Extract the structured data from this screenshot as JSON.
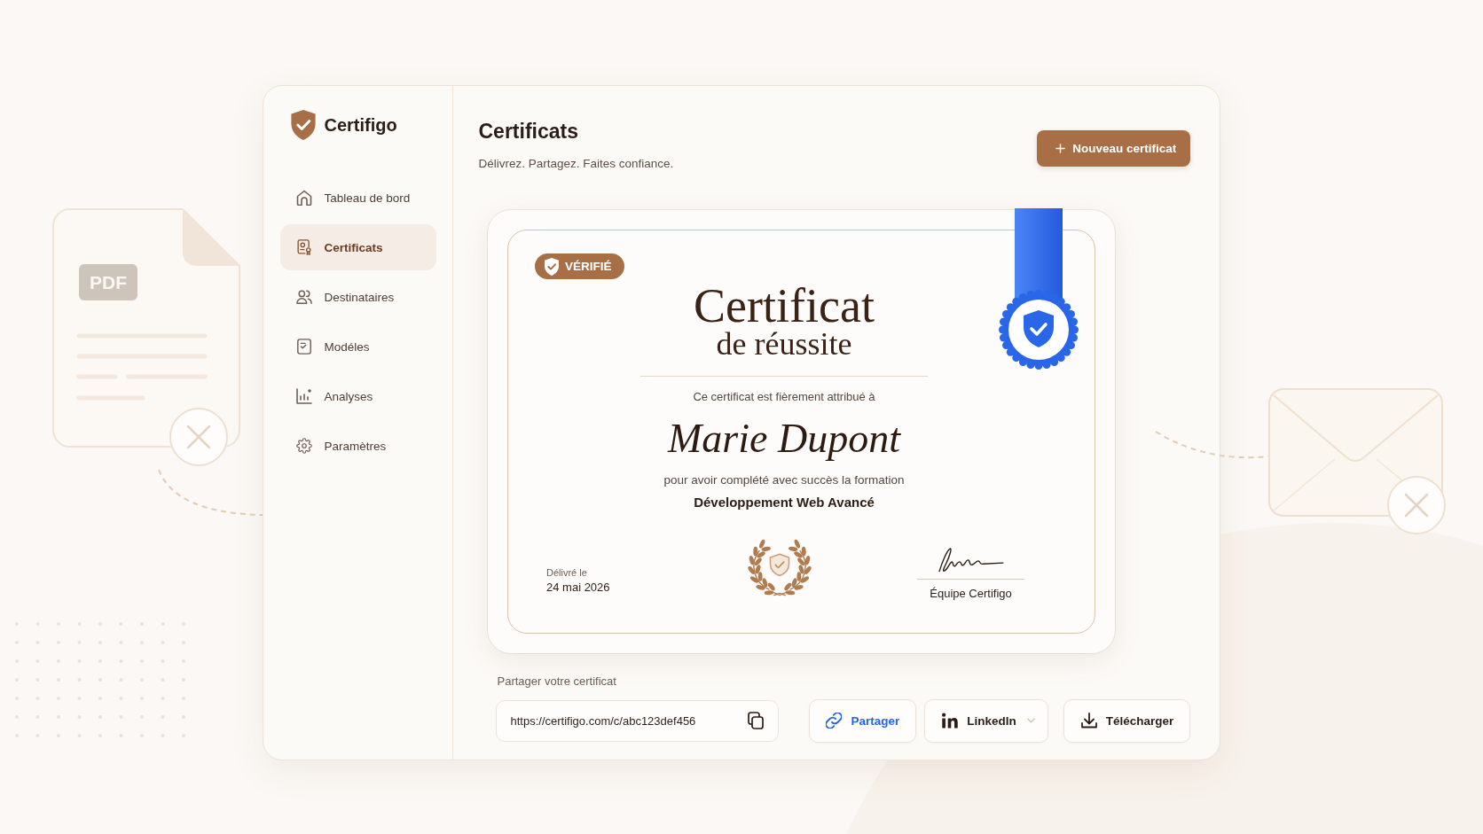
{
  "brand": {
    "name": "Certifigo"
  },
  "sidebar": {
    "items": [
      {
        "label": "Tableau de bord",
        "selected": false
      },
      {
        "label": "Certificats",
        "selected": true
      },
      {
        "label": "Destinataires",
        "selected": false
      },
      {
        "label": "Modéles",
        "selected": false
      },
      {
        "label": "Analyses",
        "selected": false
      },
      {
        "label": "Paramètres",
        "selected": false
      }
    ]
  },
  "header": {
    "title": "Certificats",
    "subtitle": "Délivrez. Partagez. Faites confiance.",
    "action": "Nouveau certificat"
  },
  "certificate": {
    "badge": "VÉRIFIÉ",
    "title": "Certificat",
    "subtitle": "de réussite",
    "intro": "Ce certificat est fièrement attribué à",
    "recipient": "Marie Dupont",
    "reason": "pour avoir complété avec succès la formation",
    "course": "Développement Web Avancé",
    "issued_label": "Délivré le",
    "issued_date": "24 mai 2026",
    "signatory": "Équipe Certifigo"
  },
  "share": {
    "label": "Partager votre certificat",
    "url": "https://certifigo.com/c/abc123def456",
    "buttons": [
      {
        "label": "Partager",
        "kind": "share"
      },
      {
        "label": "LinkedIn",
        "kind": "linkedin"
      },
      {
        "label": "Télécharger",
        "kind": "download"
      }
    ]
  },
  "illustration": {
    "document_label": "PDF"
  }
}
